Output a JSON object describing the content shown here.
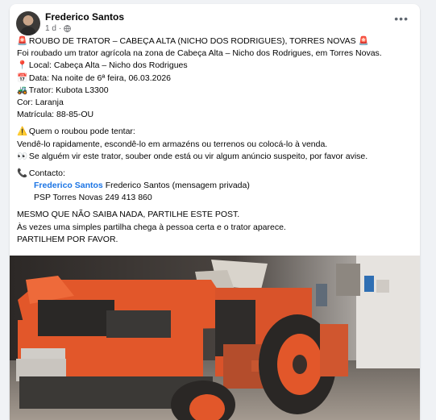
{
  "post": {
    "author": "Frederico Santos",
    "time": "1 d",
    "lines": [
      {
        "emoji": "🚨",
        "text": "ROUBO DE TRATOR – CABEÇA ALTA (NICHO DOS RODRIGUES), TORRES NOVAS 🚨"
      },
      {
        "emoji": "",
        "text": "Foi roubado um trator agrícola na zona de Cabeça Alta – Nicho dos Rodrigues, em Torres Novas."
      },
      {
        "emoji": "📍",
        "text": "Local: Cabeça Alta – Nicho dos Rodrigues"
      },
      {
        "emoji": "📅",
        "text": "Data: Na noite de 6ª feira, 06.03.2026"
      },
      {
        "emoji": "🚜",
        "text": "Trator: Kubota L3300"
      },
      {
        "emoji": "",
        "text": "Cor: Laranja"
      },
      {
        "emoji": "",
        "text": "Matrícula: 88-85-OU"
      },
      {
        "emoji": "⚠️",
        "text": "Quem o roubou pode tentar:"
      },
      {
        "emoji": "",
        "text": "Vendê-lo rapidamente, escondê-lo em armazéns ou terrenos ou colocá-lo à venda."
      },
      {
        "emoji": "👀",
        "text": "Se alguém vir este trator, souber onde está ou vir algum anúncio suspeito, por favor avise."
      },
      {
        "emoji": "📞",
        "text": "Contacto:"
      },
      {
        "link": "Frederico Santos",
        "text": " Frederico Santos (mensagem privada)"
      },
      {
        "text": "PSP Torres Novas 249 413 860"
      },
      {
        "text": "MESMO QUE NÃO SAIBA NADA, PARTILHE ESTE POST."
      },
      {
        "text": "Às vezes uma simples partilha chega à pessoa certa e o trator aparece."
      },
      {
        "text": "PARTILHEM POR FAVOR."
      }
    ],
    "icons": {
      "more": "more-options-icon",
      "audience": "globe-icon"
    },
    "colors": {
      "accent": "#1b74e4",
      "tractor": "#e2572a"
    }
  }
}
